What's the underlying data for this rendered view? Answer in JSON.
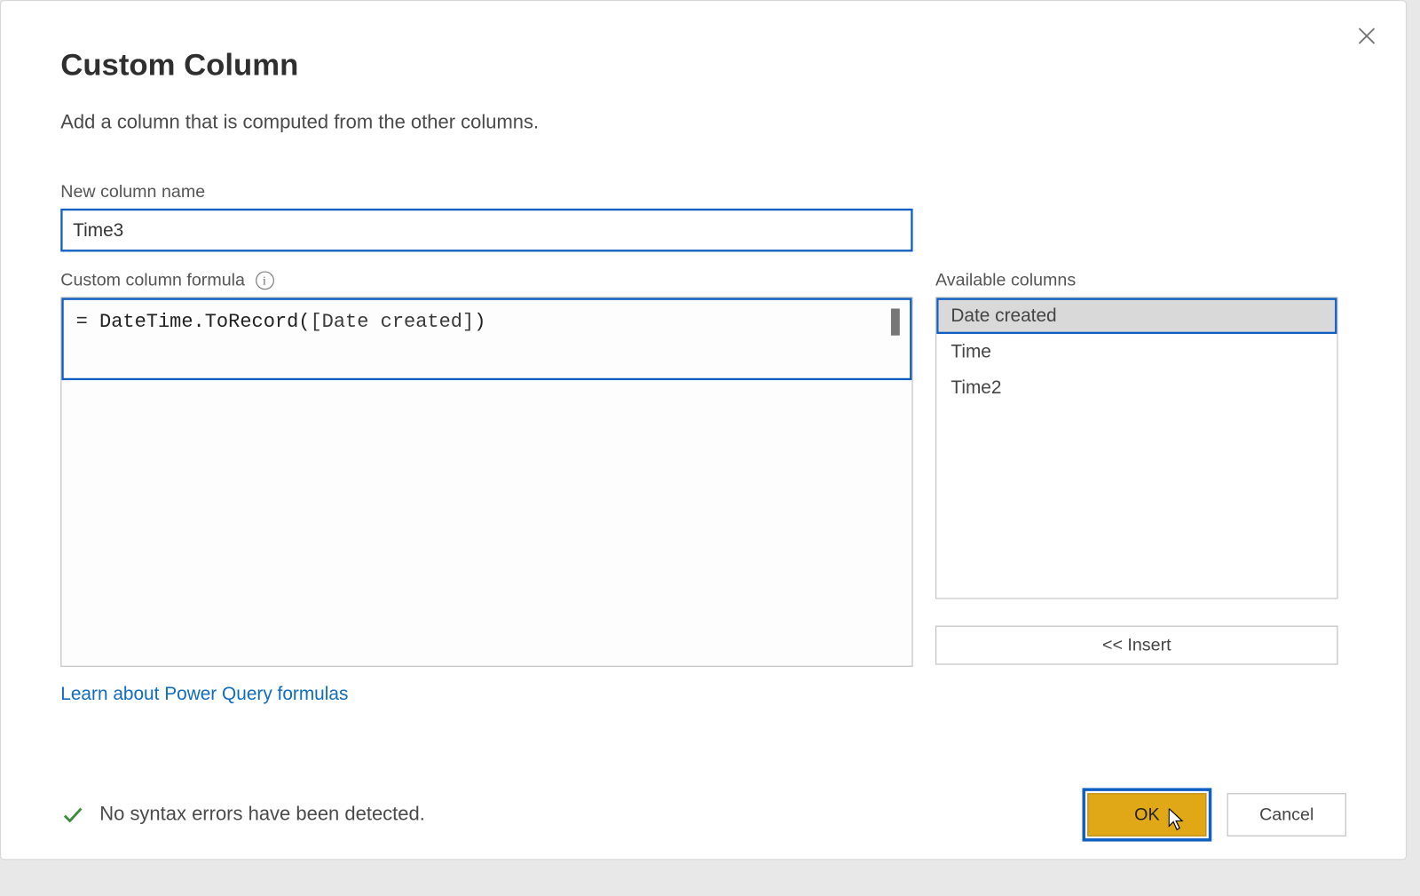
{
  "dialog": {
    "title": "Custom Column",
    "subtitle": "Add a column that is computed from the other columns.",
    "close_aria": "Close"
  },
  "name_field": {
    "label": "New column name",
    "value": "Time3"
  },
  "formula_field": {
    "label": "Custom column formula",
    "info_tooltip": "i",
    "prefix": "= ",
    "fn": "DateTime.ToRecord",
    "open": "(",
    "arg": "[Date created]",
    "close": ")"
  },
  "available": {
    "label": "Available columns",
    "items": [
      "Date created",
      "Time",
      "Time2"
    ],
    "selected_index": 0,
    "insert_label": "<< Insert"
  },
  "link": {
    "learn_label": "Learn about Power Query formulas"
  },
  "status": {
    "message": "No syntax errors have been detected."
  },
  "buttons": {
    "ok": "OK",
    "cancel": "Cancel"
  }
}
